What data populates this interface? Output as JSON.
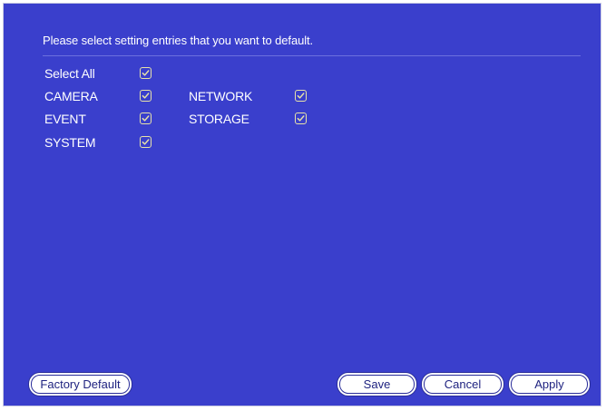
{
  "dialog": {
    "instruction": "Please select setting entries that you want to default.",
    "options": {
      "select_all": {
        "label": "Select All",
        "checked": true
      },
      "camera": {
        "label": "CAMERA",
        "checked": true
      },
      "network": {
        "label": "NETWORK",
        "checked": true
      },
      "event": {
        "label": "EVENT",
        "checked": true
      },
      "storage": {
        "label": "STORAGE",
        "checked": true
      },
      "system": {
        "label": "SYSTEM",
        "checked": true
      }
    }
  },
  "buttons": {
    "factory_default": "Factory Default",
    "save": "Save",
    "cancel": "Cancel",
    "apply": "Apply"
  },
  "colors": {
    "background": "#3a3fcc",
    "text": "#ffffff",
    "checkbox_accent": "#e8e3a8",
    "button_face": "#ffffff",
    "button_text": "#1f2380"
  },
  "icons": {
    "checkbox_mark": "checkmark-icon"
  }
}
